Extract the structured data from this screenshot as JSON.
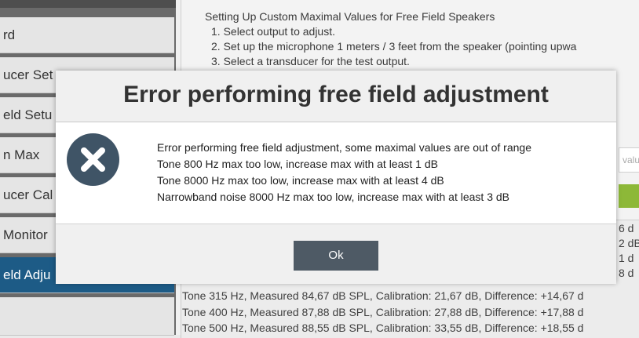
{
  "sidebar": {
    "items": [
      {
        "label": "rd"
      },
      {
        "label": "ucer Set"
      },
      {
        "label": "eld Setu"
      },
      {
        "label": "n Max"
      },
      {
        "label": "ucer Cal"
      },
      {
        "label": "Monitor"
      },
      {
        "label": "eld Adju"
      },
      {
        "label": ""
      }
    ]
  },
  "instructions": {
    "heading": "Setting Up Custom Maximal Values for Free Field Speakers",
    "steps": [
      "1. Select output to adjust.",
      "2. Set up the microphone 1 meters / 3 feet from the speaker (pointing upwa",
      "3. Select a transducer for the test output."
    ]
  },
  "input_stub": {
    "text": "valu"
  },
  "results": {
    "lines": [
      "Tone 315 Hz, Measured 84,67 dB SPL, Calibration: 21,67 dB, Difference: +14,67 d",
      "Tone 400 Hz, Measured 87,88 dB SPL, Calibration: 27,88 dB, Difference: +17,88 d",
      "Tone 500 Hz, Measured 88,55 dB SPL, Calibration: 33,55 dB, Difference: +18,55 d"
    ],
    "right_fragments": [
      "6 d",
      "2 dB",
      "1 d",
      "8 d"
    ]
  },
  "dialog": {
    "title": "Error performing free field adjustment",
    "icon": "error-x-icon",
    "messages": [
      "Error performing free field adjustment, some maximal values are out of range",
      "Tone 800 Hz max too low, increase max with at least 1 dB",
      "Tone 8000 Hz max too low, increase max with at least 4 dB",
      "Narrowband noise 8000 Hz max too low, increase max with at least 3 dB"
    ],
    "ok_label": "Ok"
  },
  "colors": {
    "active_sidebar": "#1d5b86",
    "ok_button": "#4e5a65",
    "error_icon_bg": "#3f5466",
    "green_button": "#8db838"
  }
}
